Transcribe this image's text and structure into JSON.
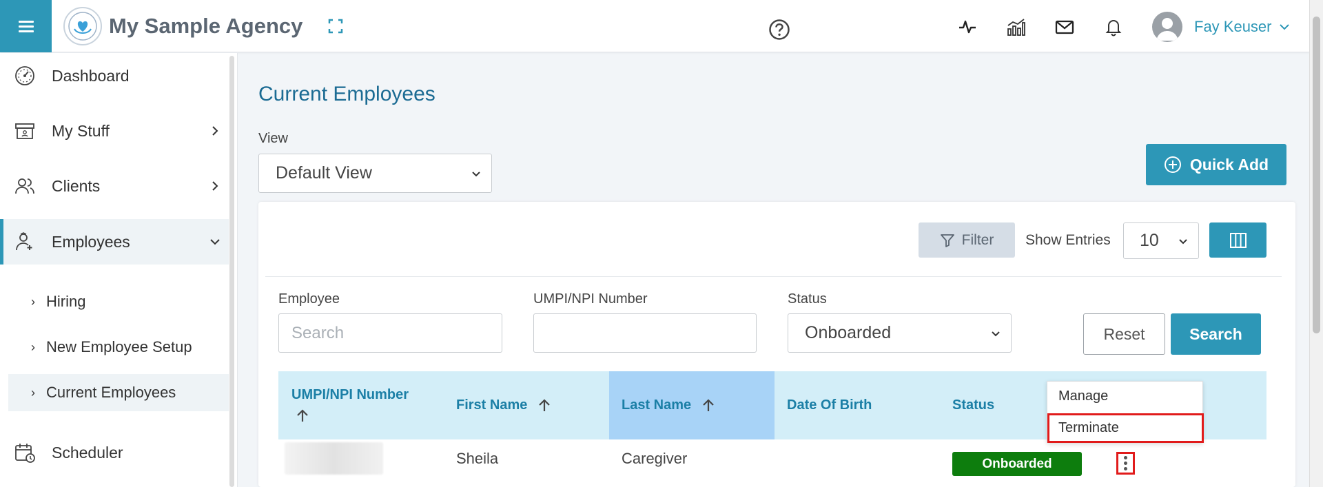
{
  "header": {
    "agency_name": "My Sample Agency",
    "username": "Fay Keuser"
  },
  "sidebar": {
    "items": [
      {
        "label": "Dashboard",
        "icon": "dashboard-gauge-icon"
      },
      {
        "label": "My Stuff",
        "icon": "archive-box-icon"
      },
      {
        "label": "Clients",
        "icon": "users-icon"
      },
      {
        "label": "Employees",
        "icon": "employee-icon"
      },
      {
        "label": "Scheduler",
        "icon": "calendar-clock-icon"
      }
    ],
    "sub_items": [
      {
        "label": "Hiring"
      },
      {
        "label": "New Employee Setup"
      },
      {
        "label": "Current Employees"
      }
    ],
    "active_item": "Employees",
    "active_sub_item": "Current Employees"
  },
  "main": {
    "title": "Current Employees",
    "view_label": "View",
    "view_value": "Default View",
    "quick_add_label": "Quick Add",
    "filter_label": "Filter",
    "show_entries_label": "Show Entries",
    "show_entries_value": "10",
    "filters": {
      "employee_label": "Employee",
      "employee_placeholder": "Search",
      "umpi_label": "UMPI/NPI Number",
      "umpi_value": "",
      "status_label": "Status",
      "status_value": "Onboarded"
    },
    "reset_label": "Reset",
    "search_label": "Search"
  },
  "table": {
    "columns": [
      {
        "label": "UMPI/NPI Number",
        "sortable": true
      },
      {
        "label": "First Name",
        "sortable": true
      },
      {
        "label": "Last Name",
        "sortable": true,
        "sorted": true
      },
      {
        "label": "Date Of Birth",
        "sortable": false
      },
      {
        "label": "Status",
        "sortable": false
      }
    ],
    "rows": [
      {
        "umpi": "",
        "first_name": "Sheila",
        "last_name": "Caregiver",
        "dob": "",
        "status": "Onboarded"
      }
    ]
  },
  "row_menu": {
    "items": [
      "Manage",
      "Terminate"
    ],
    "highlighted": "Terminate"
  },
  "colors": {
    "accent": "#2d97b7",
    "title": "#1b6b93",
    "status_onboarded": "#0d7d0d",
    "highlight_border": "#e11b1b"
  }
}
